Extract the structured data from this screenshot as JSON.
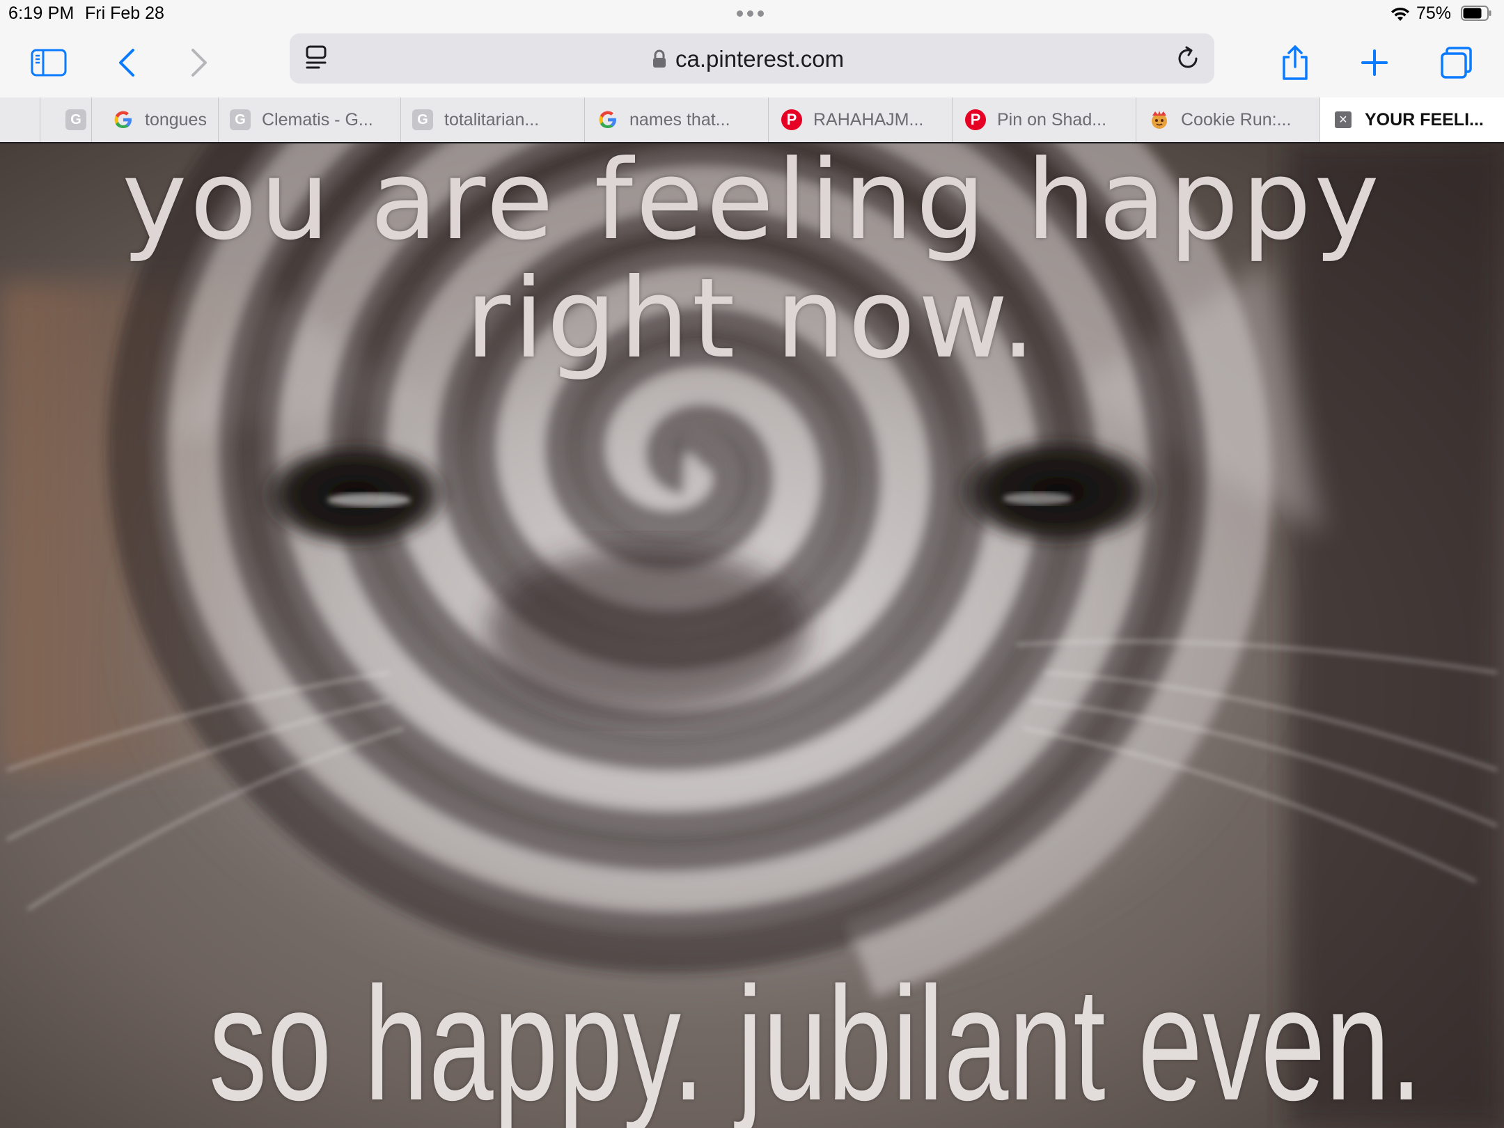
{
  "status_bar": {
    "time": "6:19 PM",
    "date": "Fri Feb 28",
    "battery_percent": "75%",
    "battery_level": 0.75
  },
  "toolbar": {
    "url": "ca.pinterest.com",
    "accent_color": "#0a7aff"
  },
  "tabs": [
    {
      "label": "",
      "icon": "blank"
    },
    {
      "label": "",
      "icon": "google-grey-icon"
    },
    {
      "label": "tongues",
      "icon": "google-icon"
    },
    {
      "label": "Clematis - G...",
      "icon": "google-grey-icon"
    },
    {
      "label": "totalitarian...",
      "icon": "google-grey-icon"
    },
    {
      "label": "names that...",
      "icon": "google-icon"
    },
    {
      "label": "RAHAHAJM...",
      "icon": "pinterest-icon"
    },
    {
      "label": "Pin on Shad...",
      "icon": "pinterest-icon"
    },
    {
      "label": "Cookie Run:...",
      "icon": "cookie-run-icon"
    },
    {
      "label": "YOUR FEELI...",
      "icon": "close-icon",
      "active": true
    }
  ],
  "content": {
    "caption_top_line1": "you are feeling happy",
    "caption_top_line2": "right now.",
    "caption_bottom": "so happy. jubilant even."
  }
}
